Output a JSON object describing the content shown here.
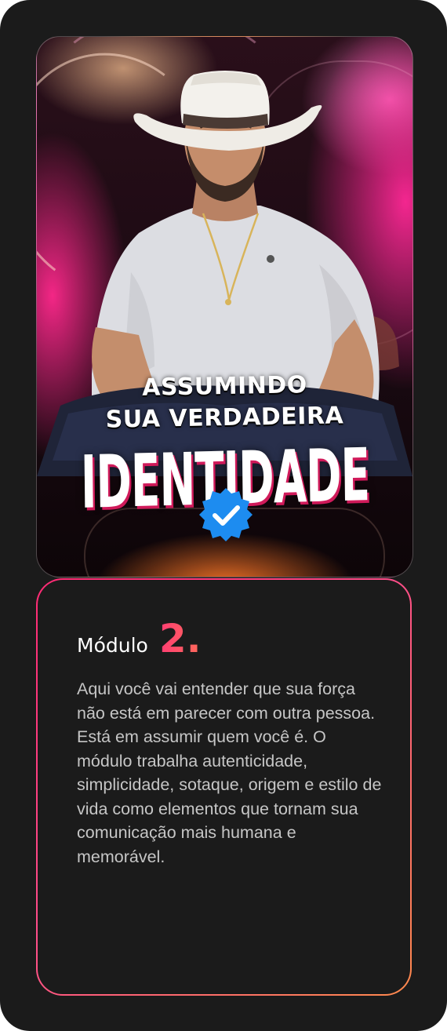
{
  "cover": {
    "title_line1": "ASSUMINDO",
    "title_line2": "SUA VERDADEIRA",
    "title_big": "IDENTIDADE",
    "badge_icon": "verified-check-icon",
    "accent_colors": [
      "#ff2a8a",
      "#ff7a2a"
    ]
  },
  "module": {
    "label": "Módulo",
    "number": "2.",
    "number_color": "#ff4d72",
    "description": "Aqui você vai entender que sua força não está em parecer com outra pessoa. Está em assumir quem você é. O módulo trabalha autenticidade, simplicidade, sotaque, origem e estilo de vida como elementos que tornam sua comunicação mais humana e memorável."
  }
}
